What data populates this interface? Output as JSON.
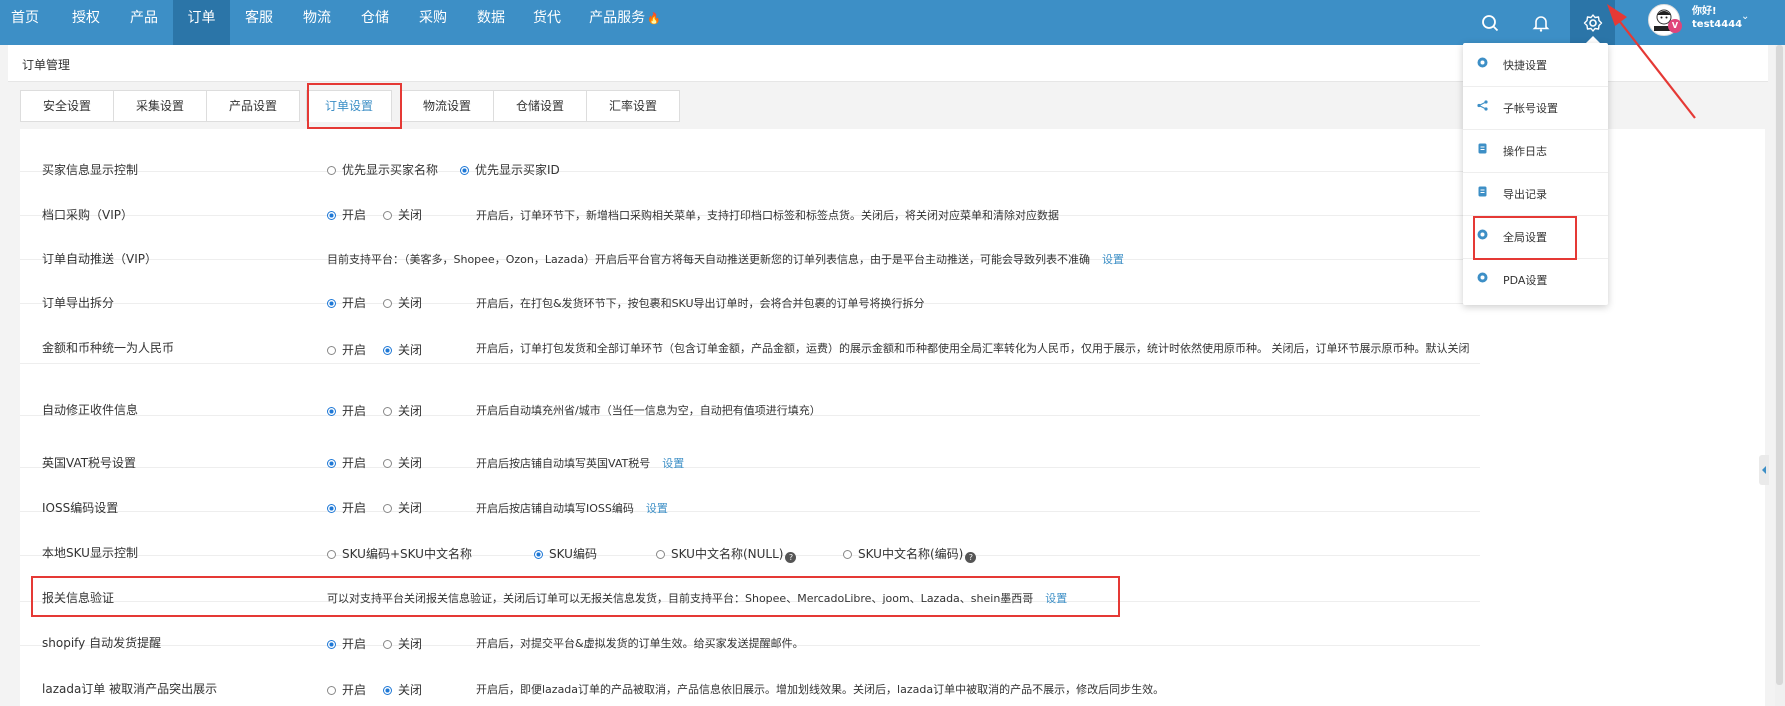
{
  "nav": {
    "items": [
      "首页",
      "授权",
      "产品",
      "订单",
      "客服",
      "物流",
      "仓储",
      "采购",
      "数据",
      "货代",
      "产品服务"
    ],
    "active_index": 3,
    "user": {
      "greeting": "你好!",
      "username": "test4444",
      "badge": "V"
    }
  },
  "breadcrumb": {
    "title": "订单管理"
  },
  "tabs": [
    "安全设置",
    "采集设置",
    "产品设置",
    "订单设置",
    "物流设置",
    "仓储设置",
    "汇率设置"
  ],
  "active_tab_index": 3,
  "settings": {
    "rows": [
      {
        "label": "买家信息显示控制",
        "opt1": "优先显示买家名称",
        "opt2": "优先显示买家ID",
        "desc": ""
      },
      {
        "label": "档口采购（VIP）",
        "opt1": "开启",
        "opt2": "关闭",
        "desc": "开启后，订单环节下，新增档口采购相关菜单，支持打印档口标签和标签点货。关闭后，将关闭对应菜单和清除对应数据"
      },
      {
        "label": "订单自动推送（VIP）",
        "desc": "目前支持平台：（美客多，Shopee，Ozon，Lazada）开启后平台官方将每天自动推送更新您的订单列表信息，由于是平台主动推送，可能会导致列表不准确",
        "link": "设置"
      },
      {
        "label": "订单导出拆分",
        "opt1": "开启",
        "opt2": "关闭",
        "desc": "开启后，在打包&发货环节下，按包裹和SKU导出订单时，会将合并包裹的订单号将换行拆分"
      },
      {
        "label": "金额和币种统一为人民币",
        "opt1": "开启",
        "opt2": "关闭",
        "desc": "开启后，订单打包发货和全部订单环节（包含订单金额，产品金额，运费）的展示金额和币种都使用全局汇率转化为人民币，仅用于展示，统计时依然使用原币种。 关闭后，订单环节展示原币种。默认关闭"
      },
      {
        "label": "自动修正收件信息",
        "opt1": "开启",
        "opt2": "关闭",
        "desc": "开启后自动填充州省/城市（当任一信息为空，自动把有值项进行填充）"
      },
      {
        "label": "英国VAT税号设置",
        "opt1": "开启",
        "opt2": "关闭",
        "desc": "开启后按店铺自动填写英国VAT税号",
        "link": "设置"
      },
      {
        "label": "IOSS编码设置",
        "opt1": "开启",
        "opt2": "关闭",
        "desc": "开启后按店铺自动填写IOSS编码",
        "link": "设置"
      },
      {
        "label": "本地SKU显示控制",
        "opt1": "SKU编码+SKU中文名称",
        "opt2": "SKU编码",
        "opt3": "SKU中文名称(NULL)",
        "opt4": "SKU中文名称(编码)"
      },
      {
        "label": "报关信息验证",
        "desc": "可以对支持平台关闭报关信息验证，关闭后订单可以无报关信息发货，目前支持平台：Shopee、MercadoLibre、joom、Lazada、shein墨西哥",
        "link": "设置"
      },
      {
        "label": "shopify 自动发货提醒",
        "opt1": "开启",
        "opt2": "关闭",
        "desc": "开启后，对提交平台&虚拟发货的订单生效。给买家发送提醒邮件。"
      },
      {
        "label": "lazada订单 被取消产品突出展示",
        "opt1": "开启",
        "opt2": "关闭",
        "desc": "开启后，即便lazada订单的产品被取消，产品信息依旧展示。增加划线效果。关闭后，lazada订单中被取消的产品不展示，修改后同步生效。"
      }
    ]
  },
  "dropdown": {
    "items": [
      "快捷设置",
      "子帐号设置",
      "操作日志",
      "导出记录",
      "全局设置",
      "PDA设置"
    ]
  }
}
